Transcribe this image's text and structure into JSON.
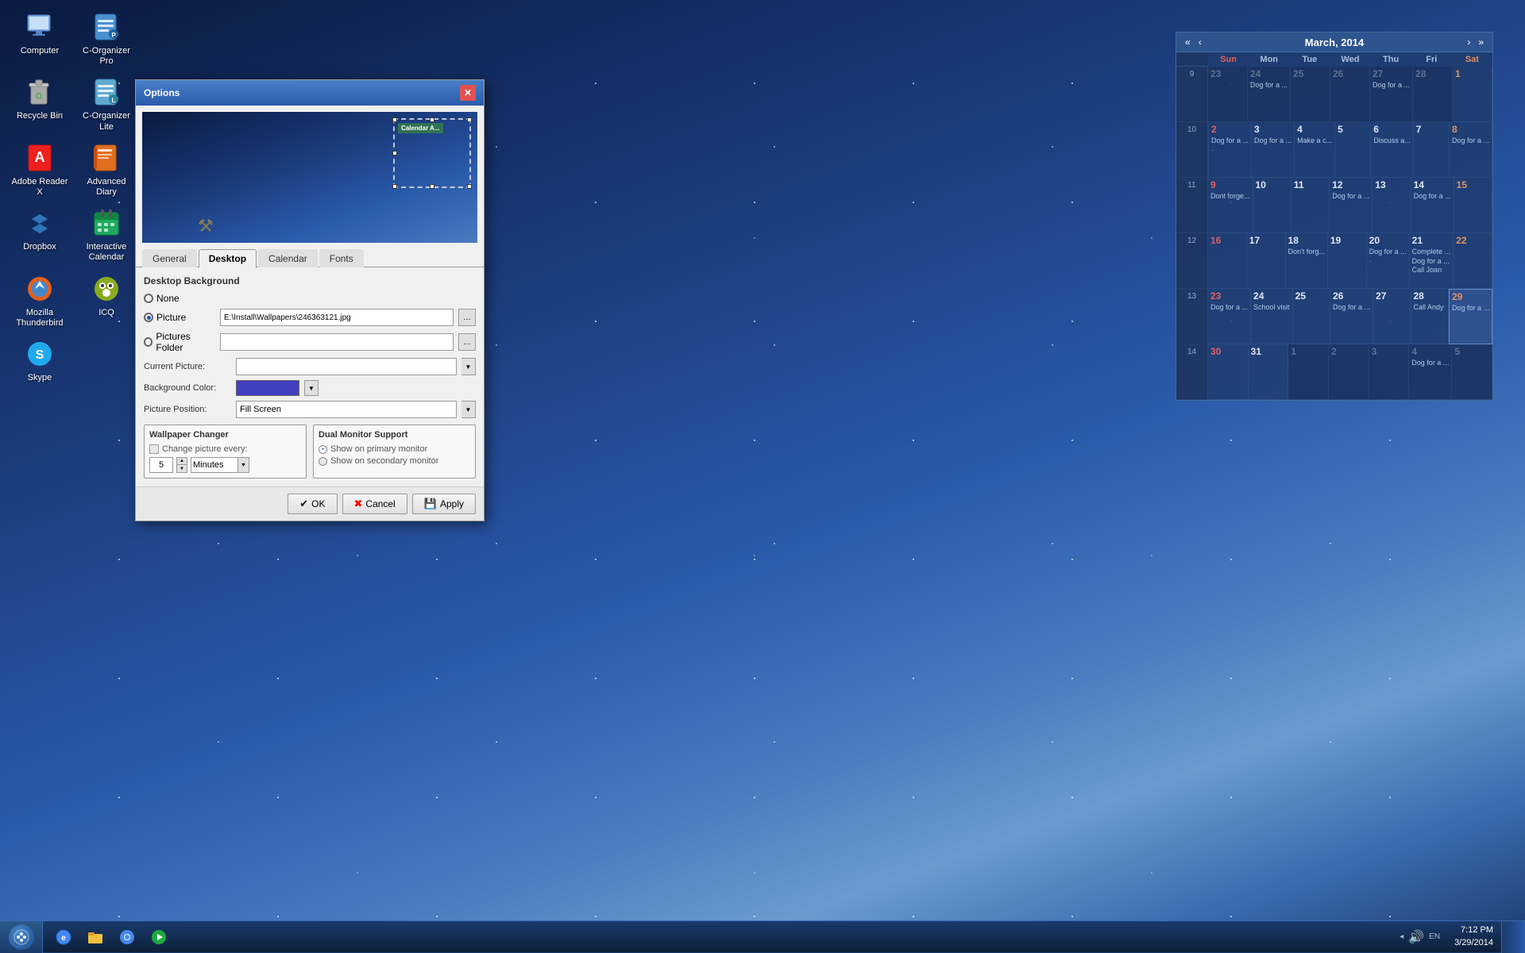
{
  "desktop": {
    "background": "blue gradient night sky",
    "icons": [
      {
        "id": "computer",
        "label": "Computer",
        "icon": "🖥"
      },
      {
        "id": "c-organizer-pro",
        "label": "C-Organizer Pro",
        "icon": "📋"
      },
      {
        "id": "recycle-bin",
        "label": "Recycle Bin",
        "icon": "🗑"
      },
      {
        "id": "c-organizer-lite",
        "label": "C-Organizer Lite",
        "icon": "📋"
      },
      {
        "id": "adobe-reader",
        "label": "Adobe Reader X",
        "icon": "📄"
      },
      {
        "id": "advanced-diary",
        "label": "Advanced Diary",
        "icon": "📓"
      },
      {
        "id": "dropbox",
        "label": "Dropbox",
        "icon": "📦"
      },
      {
        "id": "interactive-calendar",
        "label": "Interactive Calendar",
        "icon": "📅"
      },
      {
        "id": "mozilla-thunderbird",
        "label": "Mozilla Thunderbird",
        "icon": "🦊"
      },
      {
        "id": "icq",
        "label": "ICQ",
        "icon": "🌼"
      },
      {
        "id": "skype",
        "label": "Skype",
        "icon": "💬"
      }
    ]
  },
  "calendar": {
    "title": "March, 2014",
    "days_header": [
      "Sun",
      "Mon",
      "Tue",
      "Wed",
      "Thu",
      "Fri",
      "Sat"
    ],
    "week_numbers": [
      "9",
      "10",
      "11",
      "12",
      "13",
      "14"
    ],
    "weeks": [
      {
        "week": "9",
        "days": [
          {
            "date": "23",
            "month": "other",
            "events": []
          },
          {
            "date": "24",
            "month": "other",
            "events": [
              "Dog for a ..."
            ]
          },
          {
            "date": "25",
            "month": "other",
            "events": []
          },
          {
            "date": "26",
            "month": "other",
            "events": []
          },
          {
            "date": "27",
            "month": "other",
            "events": [
              "Dog for a ..."
            ]
          },
          {
            "date": "28",
            "month": "other",
            "events": []
          },
          {
            "date": "1",
            "month": "current",
            "events": [],
            "is_sat": true
          }
        ]
      },
      {
        "week": "10",
        "days": [
          {
            "date": "2",
            "month": "current",
            "events": [
              "Dog for a ..."
            ],
            "is_sun": true
          },
          {
            "date": "3",
            "month": "current",
            "events": [
              "Dog for a ..."
            ]
          },
          {
            "date": "4",
            "month": "current",
            "events": [
              "Make a c..."
            ]
          },
          {
            "date": "5",
            "month": "current",
            "events": []
          },
          {
            "date": "6",
            "month": "current",
            "events": [
              "Discuss a..."
            ]
          },
          {
            "date": "7",
            "month": "current",
            "events": []
          },
          {
            "date": "8",
            "month": "current",
            "events": [
              "Dog for a ..."
            ],
            "is_sat": true
          }
        ]
      },
      {
        "week": "11",
        "days": [
          {
            "date": "9",
            "month": "current",
            "events": [
              "Dont forge..."
            ],
            "is_sun": true
          },
          {
            "date": "10",
            "month": "current",
            "events": []
          },
          {
            "date": "11",
            "month": "current",
            "events": []
          },
          {
            "date": "12",
            "month": "current",
            "events": [
              "Dog for a ..."
            ]
          },
          {
            "date": "13",
            "month": "current",
            "events": []
          },
          {
            "date": "14",
            "month": "current",
            "events": [
              "Dog for a ..."
            ]
          },
          {
            "date": "15",
            "month": "current",
            "events": [],
            "is_sat": true
          }
        ]
      },
      {
        "week": "12",
        "days": [
          {
            "date": "16",
            "month": "current",
            "events": [],
            "is_sun": true
          },
          {
            "date": "17",
            "month": "current",
            "events": []
          },
          {
            "date": "18",
            "month": "current",
            "events": [
              "Don't forg..."
            ]
          },
          {
            "date": "19",
            "month": "current",
            "events": []
          },
          {
            "date": "20",
            "month": "current",
            "events": [
              "Dog for a ..."
            ]
          },
          {
            "date": "21",
            "month": "current",
            "events": [
              "Complete ...",
              "Dog for a ...",
              "Call Joan"
            ]
          },
          {
            "date": "22",
            "month": "current",
            "events": [],
            "is_sat": true
          }
        ]
      },
      {
        "week": "13",
        "days": [
          {
            "date": "23",
            "month": "current",
            "events": [
              "Dog for a ..."
            ],
            "is_sun": true
          },
          {
            "date": "24",
            "month": "current",
            "events": [
              "School visit"
            ]
          },
          {
            "date": "25",
            "month": "current",
            "events": []
          },
          {
            "date": "26",
            "month": "current",
            "events": [
              "Dog for a ..."
            ]
          },
          {
            "date": "27",
            "month": "current",
            "events": []
          },
          {
            "date": "28",
            "month": "current",
            "events": [
              "Call Andy"
            ]
          },
          {
            "date": "29",
            "month": "current",
            "events": [
              "Dog for a ..."
            ],
            "is_sat": true,
            "today": true
          }
        ]
      },
      {
        "week": "14",
        "days": [
          {
            "date": "30",
            "month": "current",
            "events": [],
            "is_sun": true
          },
          {
            "date": "31",
            "month": "current",
            "events": []
          },
          {
            "date": "1",
            "month": "other",
            "events": []
          },
          {
            "date": "2",
            "month": "other",
            "events": []
          },
          {
            "date": "3",
            "month": "other",
            "events": []
          },
          {
            "date": "4",
            "month": "other",
            "events": [
              "Dog for a ..."
            ]
          },
          {
            "date": "5",
            "month": "other",
            "events": [],
            "is_sat": true
          }
        ]
      }
    ]
  },
  "dialog": {
    "title": "Options",
    "tabs": [
      "General",
      "Desktop",
      "Calendar",
      "Fonts"
    ],
    "active_tab": "Desktop",
    "section_title": "Desktop Background",
    "bg_options": {
      "none_label": "None",
      "picture_label": "Picture",
      "pictures_folder_label": "Pictures Folder",
      "picture_path": "E:\\Install\\Wallpapers\\246363121.jpg",
      "current_picture_label": "Current Picture:",
      "bg_color_label": "Background Color:",
      "picture_position_label": "Picture Position:",
      "picture_position_value": "Fill Screen"
    },
    "wallpaper_changer": {
      "title": "Wallpaper Changer",
      "checkbox_label": "Change picture every:",
      "interval_value": "5",
      "interval_unit": "Minutes"
    },
    "dual_monitor": {
      "title": "Dual Monitor Support",
      "options": [
        "Show on primary monitor",
        "Show on secondary monitor"
      ],
      "selected": "Show on primary monitor"
    },
    "buttons": {
      "ok_label": "OK",
      "cancel_label": "Cancel",
      "apply_label": "Apply"
    }
  },
  "taskbar": {
    "time": "7:12 PM",
    "date": "3/29/2014",
    "language": "EN"
  }
}
